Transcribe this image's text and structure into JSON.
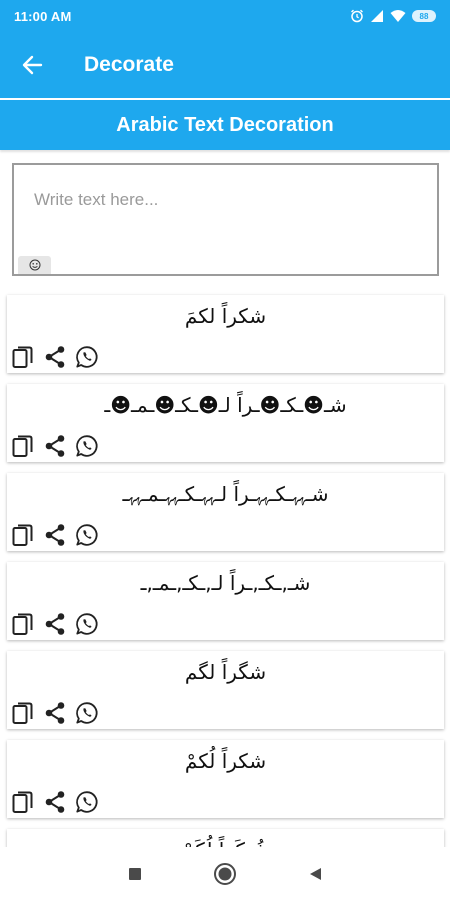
{
  "status_bar": {
    "time": "11:00 AM",
    "battery": "88"
  },
  "app_bar": {
    "title": "Decorate"
  },
  "header": {
    "title": "Arabic Text Decoration"
  },
  "input": {
    "placeholder": "Write text here...",
    "value": "",
    "emoji_icon": "emoji-icon"
  },
  "cards": [
    {
      "text": "شكراً لكمَ"
    },
    {
      "text": "شـ☻ـكـ☻ـراً لـ☻ـكـ☻ـمـ☻ـ"
    },
    {
      "text": "شـﮩﮩـكـﮩﮩـراً لـﮩﮩـكـﮩﮩـمـﮩﮩـ"
    },
    {
      "text": "شـ,ـكـ,ـراً لـ,ـكـ,ـمـ,ـ"
    },
    {
      "text": "شگراً لگم"
    },
    {
      "text": "شکراً لُکمْ"
    },
    {
      "text": "شُـكَراً لُكَمْ"
    }
  ],
  "card_actions": {
    "copy_icon": "copy-icon",
    "share_icon": "share-icon",
    "whatsapp_icon": "whatsapp-icon"
  },
  "nav": {
    "recents_icon": "square-icon",
    "home_icon": "circle-icon",
    "back_icon": "triangle-back-icon"
  },
  "colors": {
    "primary": "#1ea8ee",
    "card_bg": "#ffffff",
    "input_border": "#9b9b9b"
  }
}
